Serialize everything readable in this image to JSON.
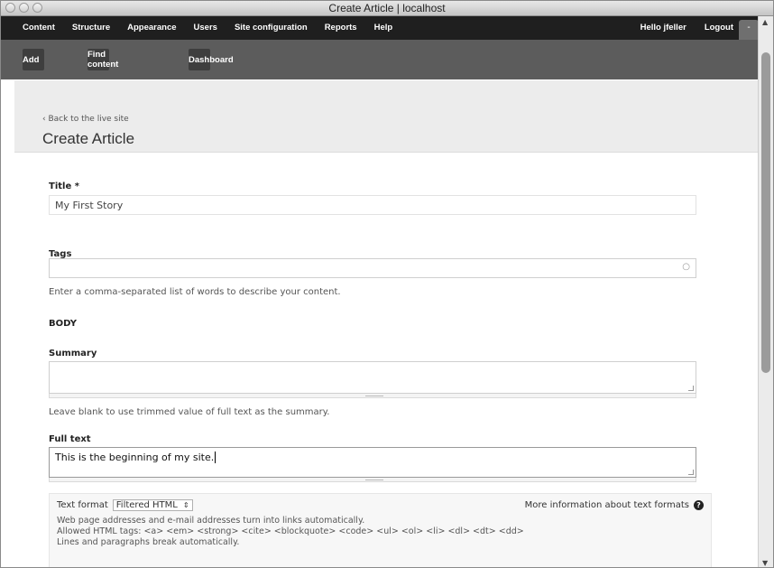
{
  "window": {
    "title": "Create Article | localhost"
  },
  "nav": {
    "items": [
      "Content",
      "Structure",
      "Appearance",
      "Users",
      "Site configuration",
      "Reports",
      "Help"
    ],
    "user_greeting": "Hello jfeller",
    "logout": "Logout",
    "toggle": "-"
  },
  "shortcuts": {
    "add": "Add",
    "find_content": "Find content",
    "dashboard": "Dashboard"
  },
  "header": {
    "back_link": "‹ Back to the live site",
    "title": "Create Article"
  },
  "form": {
    "title_label": "Title *",
    "title_value": "My First Story",
    "tags_label": "Tags",
    "tags_value": "",
    "tags_help": "Enter a comma-separated list of words to describe your content.",
    "body_heading": "BODY",
    "summary_label": "Summary",
    "summary_value": "",
    "summary_help": "Leave blank to use trimmed value of full text as the summary.",
    "fulltext_label": "Full text",
    "fulltext_value": "This is the beginning of my site.",
    "text_format_label": "Text format",
    "text_format_value": "Filtered HTML",
    "more_info": "More information about text formats",
    "format_help_1": "Web page addresses and e-mail addresses turn into links automatically.",
    "format_help_2": "Allowed HTML tags: <a> <em> <strong> <cite> <blockquote> <code> <ul> <ol> <li> <dl> <dt> <dd>",
    "format_help_3": "Lines and paragraphs break automatically."
  }
}
